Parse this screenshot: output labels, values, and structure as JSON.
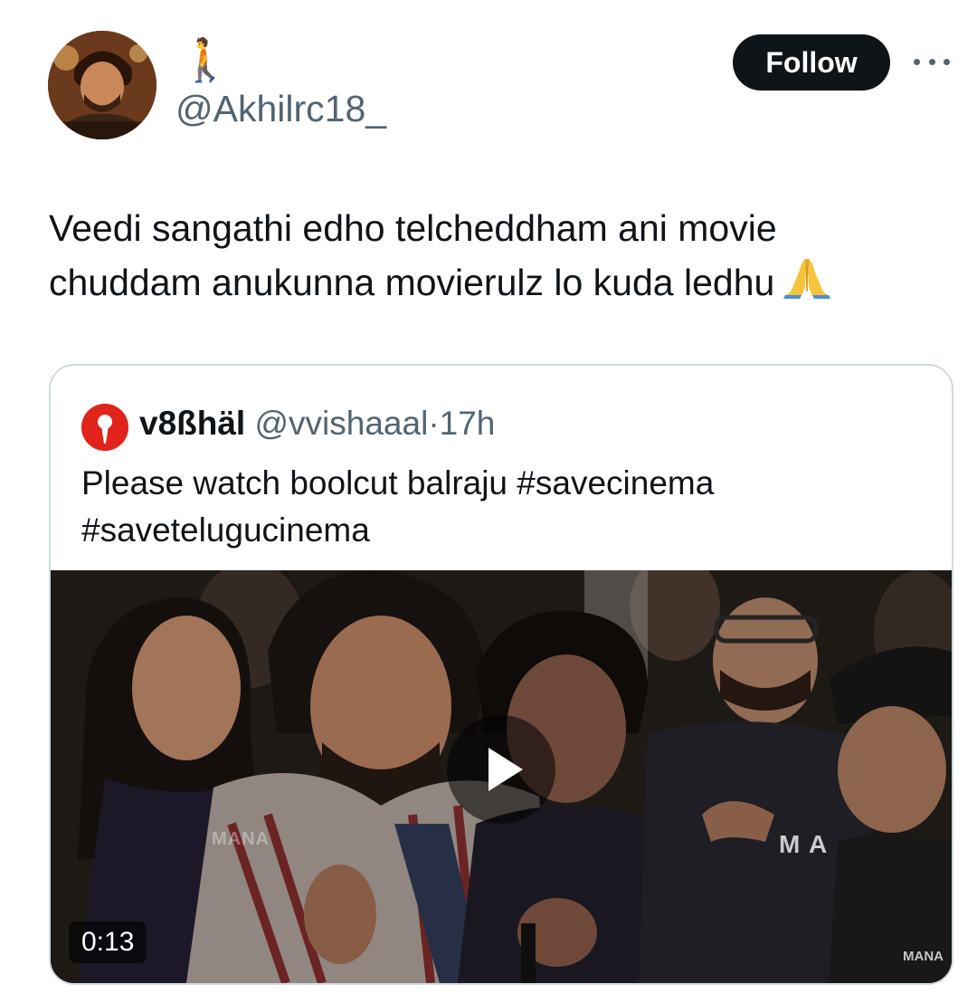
{
  "author": {
    "display_name": "🚶",
    "handle": "@Akhilrc18_",
    "avatar_icon": "profile-photo"
  },
  "actions": {
    "follow_label": "Follow",
    "more_icon": "more-dots-icon"
  },
  "tweet": {
    "lines": [
      "Veedi sangathi edho telcheddham ani movie",
      "chuddam anukunna movierulz lo kuda ledhu"
    ],
    "emoji": "folded-hands-icon"
  },
  "quoted_tweet": {
    "display_name": "v8ßhäl",
    "handle": "@vvishaaal",
    "separator": "·",
    "time": "17h",
    "lines": [
      "Please watch boolcut balraju #savecinema",
      "#savetelugucinema"
    ],
    "media": {
      "type": "video",
      "duration": "0:13",
      "watermark": "MANA",
      "watermark_corner": "MANA"
    }
  },
  "colors": {
    "text_primary": "#0f1419",
    "text_secondary": "#536471",
    "border": "#cfd9de",
    "follow_bg": "#0f1419",
    "quote_avatar": "#e0241b"
  }
}
